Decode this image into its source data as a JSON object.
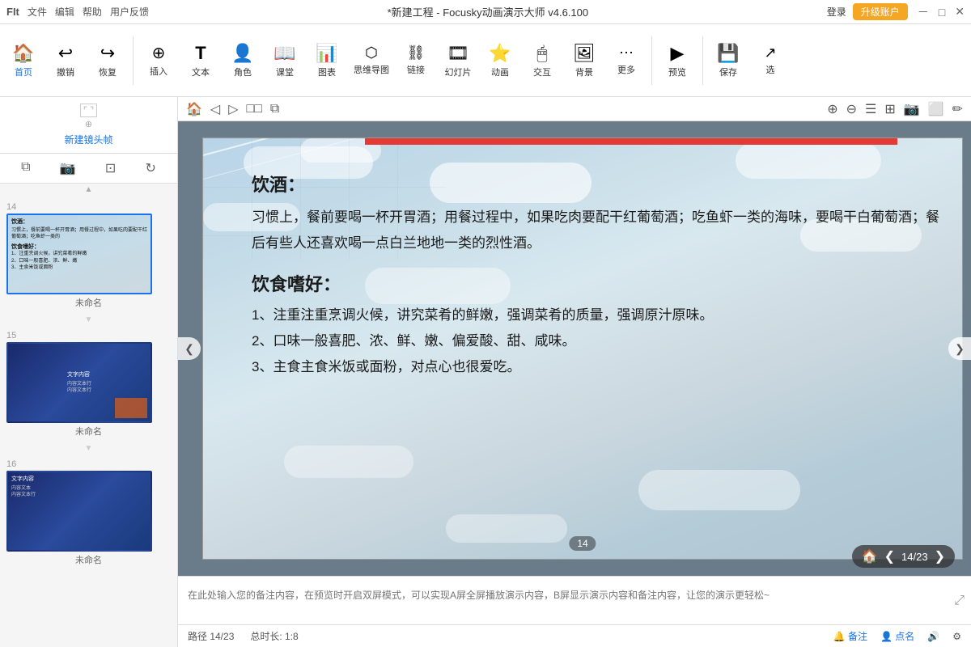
{
  "titleBar": {
    "leftIcons": [
      "■",
      "文件",
      "编辑",
      "帮助",
      "用户反馈"
    ],
    "title": "*新建工程 - Focusky动画演示大师 v4.6.100",
    "loginLabel": "登录",
    "upgradeLabel": "升级账户",
    "winBtns": [
      "－",
      "□",
      "✕"
    ]
  },
  "toolbar": {
    "items": [
      {
        "id": "home",
        "icon": "🏠",
        "label": "首页",
        "active": true
      },
      {
        "id": "undo",
        "icon": "↩",
        "label": "撤销"
      },
      {
        "id": "redo",
        "icon": "↪",
        "label": "恢复"
      },
      {
        "id": "insert",
        "icon": "⊕",
        "label": "插入"
      },
      {
        "id": "text",
        "icon": "T",
        "label": "文本"
      },
      {
        "id": "role",
        "icon": "👤",
        "label": "角色"
      },
      {
        "id": "class",
        "icon": "📖",
        "label": "课堂"
      },
      {
        "id": "chart",
        "icon": "📊",
        "label": "图表"
      },
      {
        "id": "mindmap",
        "icon": "🔗",
        "label": "思维导图"
      },
      {
        "id": "link",
        "icon": "🔗",
        "label": "链接"
      },
      {
        "id": "slide",
        "icon": "🎞",
        "label": "幻灯片"
      },
      {
        "id": "animate",
        "icon": "✨",
        "label": "动画"
      },
      {
        "id": "interact",
        "icon": "🖱",
        "label": "交互"
      },
      {
        "id": "bg",
        "icon": "🖼",
        "label": "背景"
      },
      {
        "id": "more",
        "icon": "⋯",
        "label": "更多"
      },
      {
        "id": "preview",
        "icon": "▶",
        "label": "预览"
      },
      {
        "id": "save",
        "icon": "💾",
        "label": "保存"
      },
      {
        "id": "select",
        "icon": "↗",
        "label": "选"
      }
    ]
  },
  "leftPanel": {
    "newFrameLabel": "新建镜头帧",
    "copyFrameLabel": "复制帧",
    "slides": [
      {
        "number": "14",
        "active": true,
        "name": "未命名",
        "contentLines": [
          "饮酒：",
          "习惯上，餐前要喝一杯开胃酒；",
          "用餐过程中，如果吃肉要配干",
          "红葡萄酒；吃鱼虾一类的海味，",
          "要喝干白葡萄酒；餐后有些人",
          "还喜欢喝一点白兰地地一类的烈性酒。"
        ]
      },
      {
        "number": "15",
        "active": false,
        "name": "未命名",
        "contentLines": []
      },
      {
        "number": "16",
        "active": false,
        "name": "未命名",
        "contentLines": []
      }
    ]
  },
  "canvasToolbar": {
    "icons": [
      "🏠",
      "◁",
      "▷",
      "□□",
      "⧉",
      "⊕",
      "⊖",
      "☰",
      "⬚",
      "📷",
      "⬜",
      "✎"
    ]
  },
  "slideContent": {
    "section1Title": "饮酒：",
    "section1Body": "习惯上，餐前要喝一杯开胃酒；用餐过程中，如果吃肉要配干红葡萄酒；吃鱼虾一类的海味，要喝干白葡萄酒；餐后有些人还喜欢喝一点白兰地地一类的烈性酒。",
    "section2Title": "饮食嗜好：",
    "section2Items": [
      "1、注重注重烹调火候，讲究菜肴的鲜嫩，强调菜肴的质量，强调原汁原味。",
      "2、口味一般喜肥、浓、鲜、嫩、偏爱酸、甜、咸味。",
      "3、主食主食米饭或面粉，对点心也很爱吃。"
    ]
  },
  "progress": {
    "current": "14",
    "total": "23",
    "label": "14/23"
  },
  "notesPlaceholder": "在此处输入您的备注内容，在预览时开启双屏模式，可以实现A屏全屏播放演示内容，B屏显示演示内容和备注内容，让您的演示更轻松~",
  "statusBar": {
    "path": "路径 14/23",
    "duration": "总时长: 1:8",
    "notesBtnLabel": "备注",
    "markBtnLabel": "点名",
    "rightIcons": [
      "🔊",
      "⚙"
    ]
  }
}
